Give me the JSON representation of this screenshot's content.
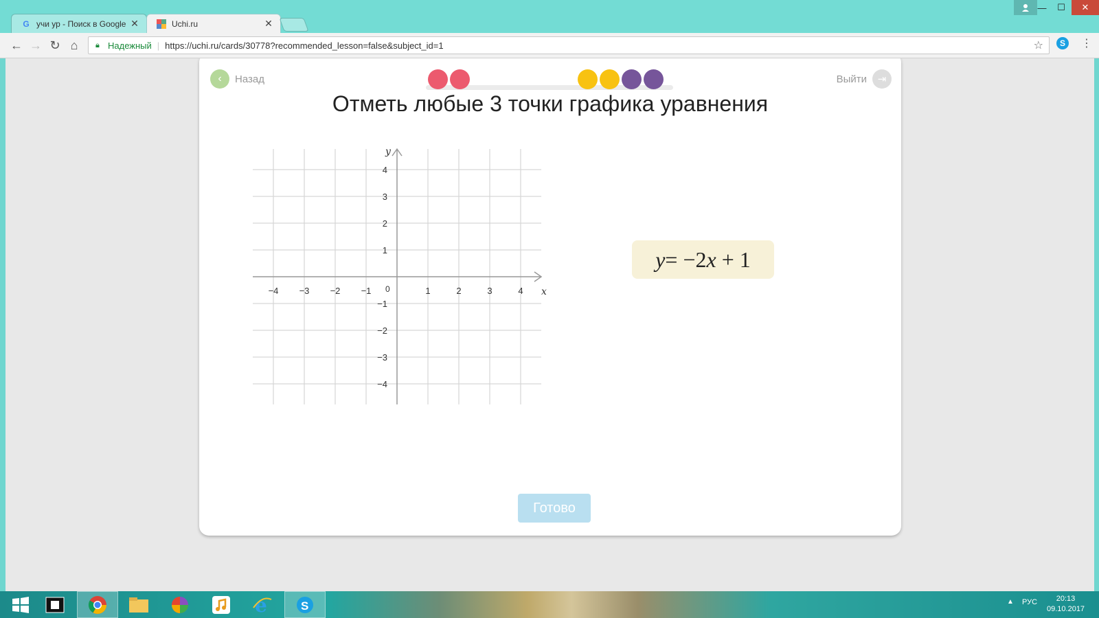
{
  "browser": {
    "tabs": [
      {
        "title": "учи ур - Поиск в Google",
        "favicon": "google-icon"
      },
      {
        "title": "Uchi.ru",
        "favicon": "uchi-icon"
      }
    ],
    "secure_label": "Надежный",
    "url": "https://uchi.ru/cards/30778?recommended_lesson=false&subject_id=1"
  },
  "card": {
    "back_label": "Назад",
    "exit_label": "Выйти",
    "progress_dots": [
      "#ec5a6e",
      "#ec5a6e",
      "#f8c211",
      "#f8c211",
      "#76559a",
      "#76559a"
    ],
    "title": "Отметь любые 3 точки графика уравнения",
    "equation": {
      "lhs": "y",
      "eq": " = −2",
      "var": "x",
      "rest": " + 1"
    },
    "done_label": "Готово"
  },
  "graph": {
    "x_label": "x",
    "y_label": "y",
    "origin_label": "0",
    "x_ticks": [
      "−4",
      "−3",
      "−2",
      "−1",
      "1",
      "2",
      "3",
      "4"
    ],
    "y_ticks": [
      "4",
      "3",
      "2",
      "1",
      "−1",
      "−2",
      "−3",
      "−4"
    ]
  },
  "taskbar": {
    "lang": "РУС",
    "time": "20:13",
    "date": "09.10.2017"
  }
}
